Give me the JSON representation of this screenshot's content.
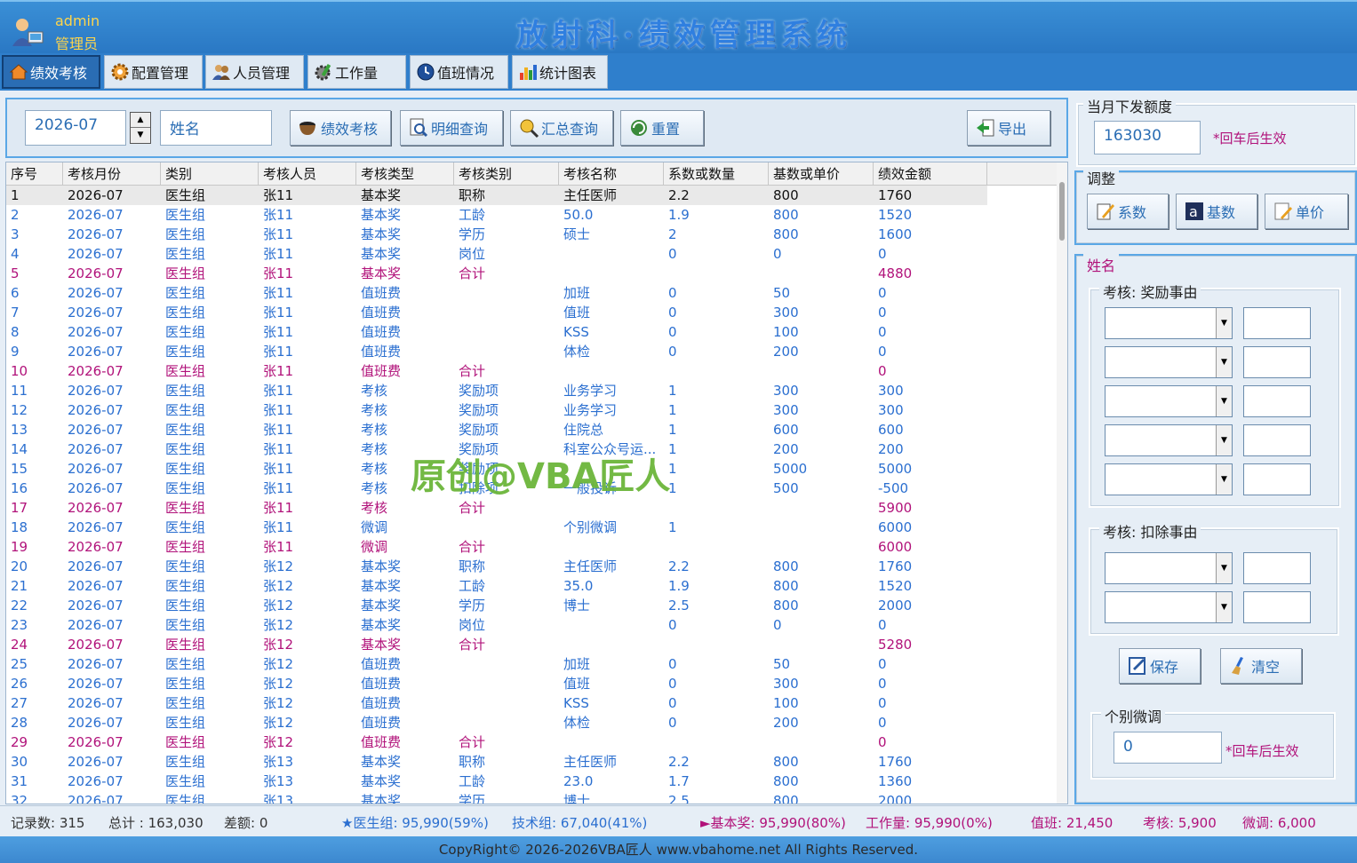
{
  "header": {
    "user_name": "admin",
    "user_role": "管理员",
    "title": "放射科·绩效管理系统"
  },
  "tabs": [
    {
      "label": "绩效考核",
      "active": true
    },
    {
      "label": "配置管理"
    },
    {
      "label": "人员管理"
    },
    {
      "label": "工作量"
    },
    {
      "label": "值班情况"
    },
    {
      "label": "统计图表"
    }
  ],
  "toolbar": {
    "month": "2026-07",
    "name_field": "姓名",
    "buttons": [
      "绩效考核",
      "明细查询",
      "汇总查询",
      "重置"
    ],
    "export": "导出"
  },
  "grid": {
    "columns": [
      "序号",
      "考核月份",
      "类别",
      "考核人员",
      "考核类型",
      "考核类别",
      "考核名称",
      "系数或数量",
      "基数或单价",
      "绩效金额"
    ],
    "rows": [
      [
        "1",
        "2026-07",
        "医生组",
        "张11",
        "基本奖",
        "职称",
        "主任医师",
        "2.2",
        "800",
        "1760",
        "b"
      ],
      [
        "2",
        "2026-07",
        "医生组",
        "张11",
        "基本奖",
        "工龄",
        "50.0",
        "1.9",
        "800",
        "1520",
        "c"
      ],
      [
        "3",
        "2026-07",
        "医生组",
        "张11",
        "基本奖",
        "学历",
        "硕士",
        "2",
        "800",
        "1600",
        "c"
      ],
      [
        "4",
        "2026-07",
        "医生组",
        "张11",
        "基本奖",
        "岗位",
        "",
        "0",
        "0",
        "0",
        "c"
      ],
      [
        "5",
        "2026-07",
        "医生组",
        "张11",
        "基本奖",
        "合计",
        "",
        "",
        "",
        "4880",
        "p"
      ],
      [
        "6",
        "2026-07",
        "医生组",
        "张11",
        "值班费",
        "",
        "加班",
        "0",
        "50",
        "0",
        "c"
      ],
      [
        "7",
        "2026-07",
        "医生组",
        "张11",
        "值班费",
        "",
        "值班",
        "0",
        "300",
        "0",
        "c"
      ],
      [
        "8",
        "2026-07",
        "医生组",
        "张11",
        "值班费",
        "",
        "KSS",
        "0",
        "100",
        "0",
        "c"
      ],
      [
        "9",
        "2026-07",
        "医生组",
        "张11",
        "值班费",
        "",
        "体检",
        "0",
        "200",
        "0",
        "c"
      ],
      [
        "10",
        "2026-07",
        "医生组",
        "张11",
        "值班费",
        "合计",
        "",
        "",
        "",
        "0",
        "p"
      ],
      [
        "11",
        "2026-07",
        "医生组",
        "张11",
        "考核",
        "奖励项",
        "业务学习",
        "1",
        "300",
        "300",
        "c"
      ],
      [
        "12",
        "2026-07",
        "医生组",
        "张11",
        "考核",
        "奖励项",
        "业务学习",
        "1",
        "300",
        "300",
        "c"
      ],
      [
        "13",
        "2026-07",
        "医生组",
        "张11",
        "考核",
        "奖励项",
        "住院总",
        "1",
        "600",
        "600",
        "c"
      ],
      [
        "14",
        "2026-07",
        "医生组",
        "张11",
        "考核",
        "奖励项",
        "科室公众号运...",
        "1",
        "200",
        "200",
        "c"
      ],
      [
        "15",
        "2026-07",
        "医生组",
        "张11",
        "考核",
        "奖励项",
        "",
        "1",
        "5000",
        "5000",
        "c"
      ],
      [
        "16",
        "2026-07",
        "医生组",
        "张11",
        "考核",
        "扣除项",
        "一般投诉",
        "1",
        "500",
        "-500",
        "c"
      ],
      [
        "17",
        "2026-07",
        "医生组",
        "张11",
        "考核",
        "合计",
        "",
        "",
        "",
        "5900",
        "p"
      ],
      [
        "18",
        "2026-07",
        "医生组",
        "张11",
        "微调",
        "",
        "个别微调",
        "1",
        "",
        "6000",
        "c"
      ],
      [
        "19",
        "2026-07",
        "医生组",
        "张11",
        "微调",
        "合计",
        "",
        "",
        "",
        "6000",
        "p"
      ],
      [
        "20",
        "2026-07",
        "医生组",
        "张12",
        "基本奖",
        "职称",
        "主任医师",
        "2.2",
        "800",
        "1760",
        "c"
      ],
      [
        "21",
        "2026-07",
        "医生组",
        "张12",
        "基本奖",
        "工龄",
        "35.0",
        "1.9",
        "800",
        "1520",
        "c"
      ],
      [
        "22",
        "2026-07",
        "医生组",
        "张12",
        "基本奖",
        "学历",
        "博士",
        "2.5",
        "800",
        "2000",
        "c"
      ],
      [
        "23",
        "2026-07",
        "医生组",
        "张12",
        "基本奖",
        "岗位",
        "",
        "0",
        "0",
        "0",
        "c"
      ],
      [
        "24",
        "2026-07",
        "医生组",
        "张12",
        "基本奖",
        "合计",
        "",
        "",
        "",
        "5280",
        "p"
      ],
      [
        "25",
        "2026-07",
        "医生组",
        "张12",
        "值班费",
        "",
        "加班",
        "0",
        "50",
        "0",
        "c"
      ],
      [
        "26",
        "2026-07",
        "医生组",
        "张12",
        "值班费",
        "",
        "值班",
        "0",
        "300",
        "0",
        "c"
      ],
      [
        "27",
        "2026-07",
        "医生组",
        "张12",
        "值班费",
        "",
        "KSS",
        "0",
        "100",
        "0",
        "c"
      ],
      [
        "28",
        "2026-07",
        "医生组",
        "张12",
        "值班费",
        "",
        "体检",
        "0",
        "200",
        "0",
        "c"
      ],
      [
        "29",
        "2026-07",
        "医生组",
        "张12",
        "值班费",
        "合计",
        "",
        "",
        "",
        "0",
        "p"
      ],
      [
        "30",
        "2026-07",
        "医生组",
        "张13",
        "基本奖",
        "职称",
        "主任医师",
        "2.2",
        "800",
        "1760",
        "c"
      ],
      [
        "31",
        "2026-07",
        "医生组",
        "张13",
        "基本奖",
        "工龄",
        "23.0",
        "1.7",
        "800",
        "1360",
        "c"
      ],
      [
        "32",
        "2026-07",
        "医生组",
        "张13",
        "基本奖",
        "学历",
        "博士",
        "2.5",
        "800",
        "2000",
        "c"
      ]
    ]
  },
  "watermark": "原创@VBA匠人",
  "right_panel": {
    "quota_label": "当月下发额度",
    "quota_value": "163030",
    "quota_hint": "*回车后生效",
    "adjust_label": "调整",
    "adjust_buttons": [
      "系数",
      "基数",
      "单价"
    ],
    "name_label": "姓名",
    "reward_label": "考核: 奖励事由",
    "deduct_label": "考核: 扣除事由",
    "save": "保存",
    "clear": "清空",
    "micro_label": "个别微调",
    "micro_value": "0",
    "micro_hint": "*回车后生效"
  },
  "status": {
    "records": "记录数: 315",
    "total": "总计 : 163,030",
    "diff": "差额: 0",
    "doctor": "★医生组: 95,990(59%)",
    "tech": "技术组: 67,040(41%)",
    "base": "►基本奖: 95,990(80%)",
    "workload": "工作量: 95,990(0%)",
    "duty": "值班: 21,450",
    "assess": "考核: 5,900",
    "micro": "微调: 6,000"
  },
  "footer": "CopyRight© 2026-2026VBA匠人 www.vbahome.net All Rights Reserved.",
  "colors": {
    "accent_blue": "#2b6fd0",
    "total_pink": "#b1127a",
    "header_blue": "#2a78c4"
  }
}
